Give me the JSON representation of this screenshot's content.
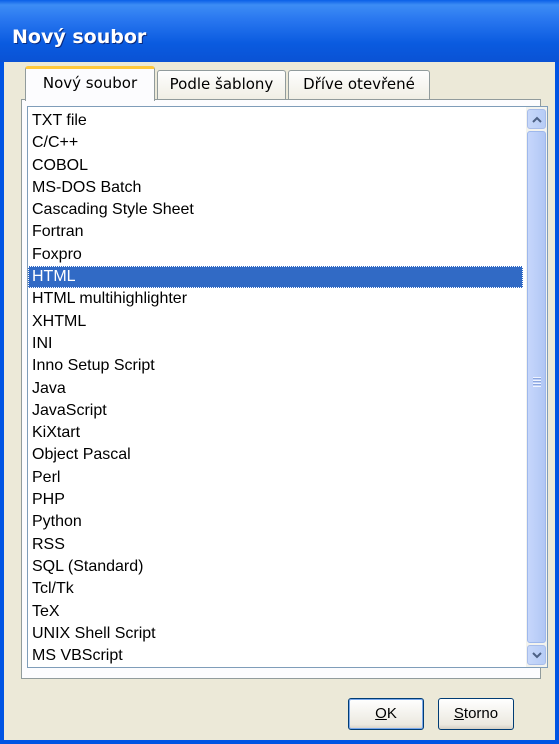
{
  "window": {
    "title": "Nový soubor"
  },
  "tabs": [
    {
      "label": "Nový soubor",
      "active": true
    },
    {
      "label": "Podle šablony",
      "active": false
    },
    {
      "label": "Dříve otevřené",
      "active": false
    }
  ],
  "list": {
    "selected": "HTML",
    "items": [
      "TXT file",
      "C/C++",
      "COBOL",
      "MS-DOS Batch",
      "Cascading Style Sheet",
      "Fortran",
      "Foxpro",
      "HTML",
      "HTML multihighlighter",
      "XHTML",
      "INI",
      "Inno Setup Script",
      "Java",
      "JavaScript",
      "KiXtart",
      "Object Pascal",
      "Perl",
      "PHP",
      "Python",
      "RSS",
      "SQL (Standard)",
      "Tcl/Tk",
      "TeX",
      "UNIX Shell Script",
      "MS VBScript"
    ]
  },
  "buttons": {
    "ok_first": "O",
    "ok_rest": "K",
    "storno_first": "S",
    "storno_rest": "torno"
  },
  "colors": {
    "selection": "#316ac5",
    "titlebar": "#0a5be0",
    "active_tab_accent": "#ffc83c"
  }
}
